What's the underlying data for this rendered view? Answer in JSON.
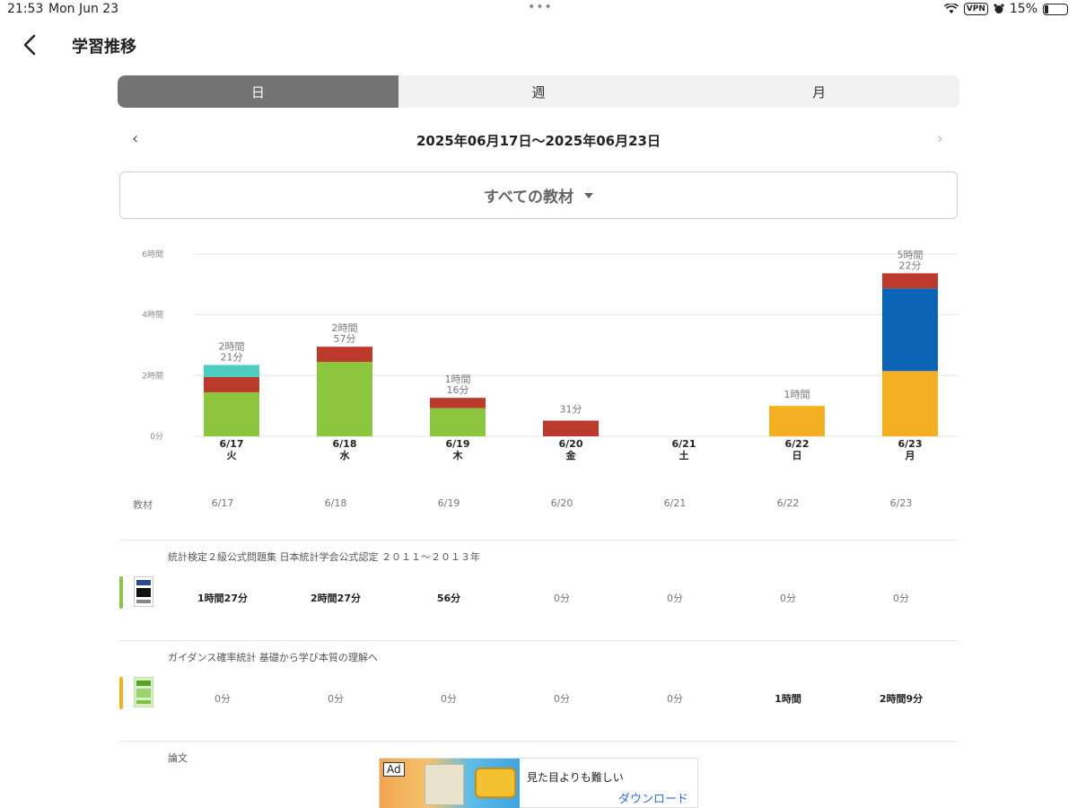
{
  "status": {
    "time": "21:53",
    "date": "Mon Jun 23",
    "vpn": "VPN",
    "battery": "15%"
  },
  "header": {
    "title": "学習推移"
  },
  "tabs": [
    {
      "label": "日"
    },
    {
      "label": "週"
    },
    {
      "label": "月"
    }
  ],
  "date_range": {
    "label": "2025年06月17日〜2025年06月23日",
    "prev": "‹",
    "next": "›"
  },
  "material_select": {
    "label": "すべての教材"
  },
  "chart_data": {
    "type": "bar",
    "stacked": true,
    "y_ticks": [
      "0分",
      "2時間",
      "4時間",
      "6時間"
    ],
    "ylim": [
      0,
      6
    ],
    "categories": [
      "6/17",
      "6/18",
      "6/19",
      "6/20",
      "6/21",
      "6/22",
      "6/23"
    ],
    "weekdays": [
      "火",
      "水",
      "木",
      "金",
      "土",
      "日",
      "月"
    ],
    "totals": [
      {
        "l1": "2時間",
        "l2": "21分",
        "value": 2.35
      },
      {
        "l1": "2時間",
        "l2": "57分",
        "value": 2.95
      },
      {
        "l1": "1時間",
        "l2": "16分",
        "value": 1.267
      },
      {
        "l1": "31分",
        "l2": "",
        "value": 0.517
      },
      {
        "l1": "",
        "l2": "",
        "value": 0
      },
      {
        "l1": "1時間",
        "l2": "",
        "value": 1.0
      },
      {
        "l1": "5時間",
        "l2": "22分",
        "value": 5.367
      }
    ],
    "series": [
      {
        "color": "#8cc63f",
        "values": [
          1.45,
          2.45,
          0.93,
          0,
          0,
          0,
          0
        ]
      },
      {
        "color": "#f3b020",
        "values": [
          0,
          0,
          0,
          0,
          0,
          1.0,
          2.15
        ]
      },
      {
        "color": "#0b64b6",
        "values": [
          0,
          0,
          0,
          0,
          0,
          0,
          2.72
        ]
      },
      {
        "color": "#bc3a2b",
        "values": [
          0.5,
          0.5,
          0.337,
          0.517,
          0,
          0,
          0.497
        ]
      },
      {
        "color": "#4ecdc1",
        "values": [
          0.4,
          0,
          0,
          0,
          0,
          0,
          0
        ]
      }
    ]
  },
  "table": {
    "header_label": "教材",
    "dates": [
      "6/17",
      "6/18",
      "6/19",
      "6/20",
      "6/21",
      "6/22",
      "6/23"
    ],
    "rows": [
      {
        "title": "統計検定２級公式問題集 日本統計学会公式認定 ２０１１〜２０１３年",
        "color": "#8cc63f",
        "values": [
          "1時間27分",
          "2時間27分",
          "56分",
          "0分",
          "0分",
          "0分",
          "0分"
        ],
        "bold": [
          true,
          true,
          true,
          false,
          false,
          false,
          false
        ]
      },
      {
        "title": "ガイダンス確率統計 基礎から学び本質の理解へ",
        "color": "#f3b020",
        "values": [
          "0分",
          "0分",
          "0分",
          "0分",
          "0分",
          "1時間",
          "2時間9分"
        ],
        "bold": [
          false,
          false,
          false,
          false,
          false,
          true,
          true
        ]
      }
    ],
    "row3_title": "論文"
  },
  "ad": {
    "tag": "Ad",
    "text": "見た目よりも難しい",
    "cta": "ダウンロード"
  }
}
